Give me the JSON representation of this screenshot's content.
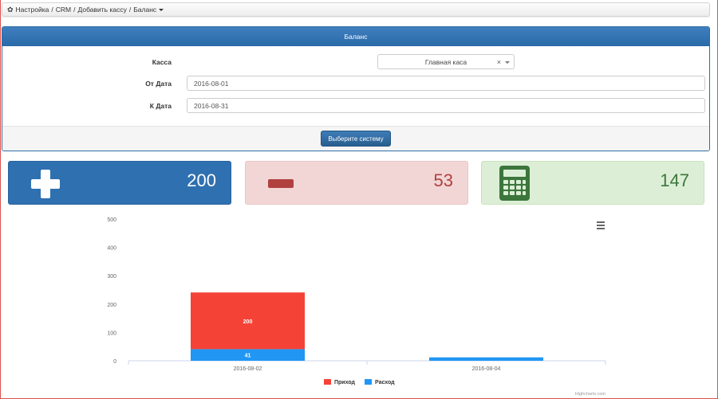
{
  "breadcrumb": {
    "items": [
      "Настройка",
      "CRM",
      "Добавить кассу",
      "Баланс"
    ],
    "separator": "/"
  },
  "panel": {
    "title": "Баланс",
    "fields": {
      "kassa": {
        "label": "Касса",
        "value": "Главная каса"
      },
      "from_date": {
        "label": "От Дата",
        "value": "2016-08-01"
      },
      "to_date": {
        "label": "К Дата",
        "value": "2016-08-31"
      }
    },
    "submit_label": "Выберите систему"
  },
  "stats": {
    "income": {
      "value": "200",
      "icon": "plus-icon",
      "color": "#2f70b0"
    },
    "expense": {
      "value": "53",
      "icon": "minus-icon",
      "color": "#b0413e"
    },
    "balance": {
      "value": "147",
      "icon": "calculator-icon",
      "color": "#3c763d"
    }
  },
  "chart_data": {
    "type": "bar",
    "stacked": true,
    "categories": [
      "2016-08-02",
      "2016-08-04"
    ],
    "series": [
      {
        "name": "Приход",
        "values": [
          200,
          0
        ],
        "color": "#f44336"
      },
      {
        "name": "Расход",
        "values": [
          41,
          12
        ],
        "color": "#2196f3"
      }
    ],
    "ylim": [
      0,
      500
    ],
    "yticks": [
      0,
      100,
      200,
      300,
      400,
      500
    ],
    "data_labels": {
      "Приход": [
        "200",
        ""
      ],
      "Расход": [
        "41",
        ""
      ]
    },
    "legend_position": "bottom",
    "credits": "Highcharts.com"
  }
}
